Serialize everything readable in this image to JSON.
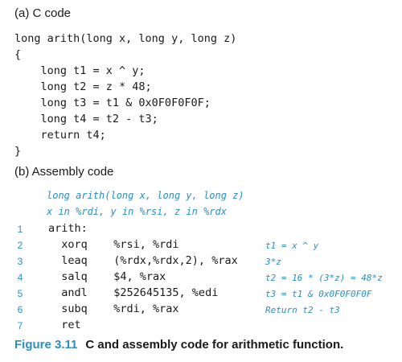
{
  "section_a": {
    "title": "(a) C code",
    "lines": [
      "long arith(long x, long y, long z)",
      "{",
      "    long t1 = x ^ y;",
      "    long t2 = z * 48;",
      "    long t3 = t1 & 0x0F0F0F0F;",
      "    long t4 = t2 - t3;",
      "    return t4;",
      "}"
    ]
  },
  "section_b": {
    "title": "(b) Assembly code",
    "header_comments": [
      "long arith(long x, long y, long z)",
      "x in %rdi, y in %rsi, z in %rdx"
    ],
    "rows": [
      {
        "num": "1",
        "code": "arith:",
        "note": ""
      },
      {
        "num": "2",
        "code": "  xorq    %rsi, %rdi",
        "note": "t1 = x ^ y"
      },
      {
        "num": "3",
        "code": "  leaq    (%rdx,%rdx,2), %rax",
        "note": "3*z"
      },
      {
        "num": "4",
        "code": "  salq    $4, %rax",
        "note": "t2 = 16 * (3*z) = 48*z"
      },
      {
        "num": "5",
        "code": "  andl    $252645135, %edi",
        "note": "t3 = t1 & 0x0F0F0F0F"
      },
      {
        "num": "6",
        "code": "  subq    %rdi, %rax",
        "note": "Return t2 - t3"
      },
      {
        "num": "7",
        "code": "  ret",
        "note": ""
      }
    ]
  },
  "caption": {
    "figure": "Figure 3.11",
    "text": "C and assembly code for arithmetic function."
  }
}
